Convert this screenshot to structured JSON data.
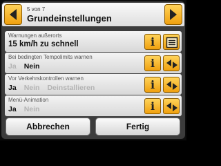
{
  "header": {
    "page_indicator": "5 von 7",
    "title": "Grundeinstellungen"
  },
  "rows": [
    {
      "label": "Warnungen außerorts",
      "value": "15 km/h zu schnell",
      "side_icon": "list-icon"
    },
    {
      "label": "Bei bedingten Tempolimits warnen",
      "options": [
        "Ja",
        "Nein"
      ],
      "selected": "Nein",
      "side_icon": "toggle-arrows-icon"
    },
    {
      "label": "Vor Verkehrskontrollen warnen",
      "options": [
        "Ja",
        "Nein",
        "Deinstallieren"
      ],
      "selected": "Ja",
      "side_icon": "toggle-arrows-icon"
    },
    {
      "label": "Menü-Animation",
      "options": [
        "Ja",
        "Nein"
      ],
      "selected": "Ja",
      "side_icon": "toggle-arrows-icon"
    }
  ],
  "info_symbol": "i",
  "buttons": {
    "cancel": "Abbrechen",
    "done": "Fertig"
  },
  "colors": {
    "accent": "#f5a815",
    "selected_text": "#111111",
    "unselected_text": "#b4b4b4"
  }
}
